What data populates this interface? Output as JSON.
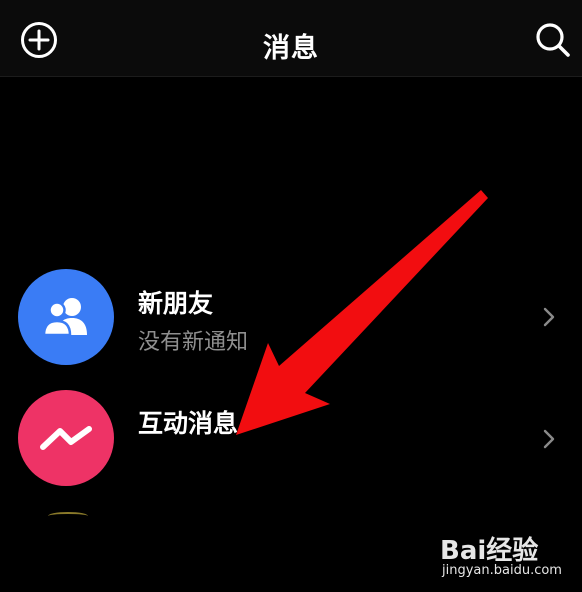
{
  "header": {
    "title": "消息",
    "add_icon": "plus-circle-icon",
    "search_icon": "search-icon"
  },
  "list": [
    {
      "title": "新朋友",
      "subtitle": "没有新通知",
      "icon": "people-icon",
      "color": "#3a7cf5"
    },
    {
      "title": "互动消息",
      "icon": "zigzag-icon",
      "color": "#ee3366"
    }
  ],
  "annotation": {
    "arrow_color": "#f20d10"
  },
  "watermark": {
    "brand": "Bai经验",
    "url": "jingyan.baidu.com"
  }
}
